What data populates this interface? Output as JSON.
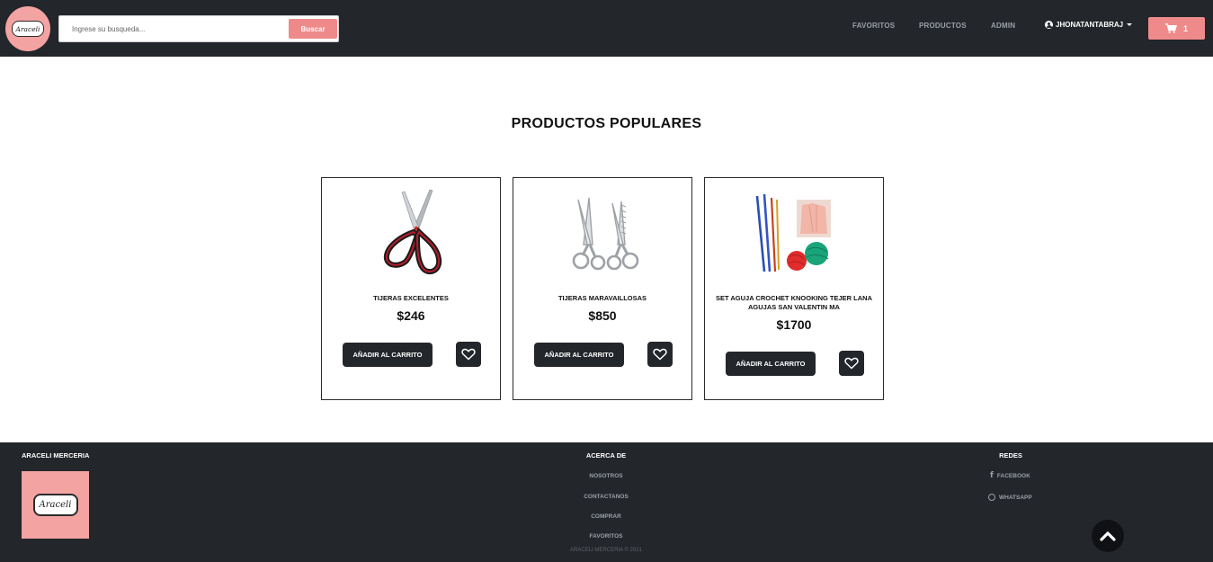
{
  "header": {
    "logo_text": "Araceli",
    "search": {
      "placeholder": "Ingrese su busqueda...",
      "value": "",
      "button_label": "Buscar"
    },
    "nav": [
      {
        "label": "FAVORITOS"
      },
      {
        "label": "PRODUCTOS"
      },
      {
        "label": "ADMIN"
      }
    ],
    "user": {
      "name": "JHONATANTABRAJ",
      "icon": "user-circle-icon"
    },
    "cart": {
      "count": "1",
      "icon": "shopping-cart-icon"
    }
  },
  "main": {
    "title": "PRODUCTOS POPULARES",
    "products": [
      {
        "name": "TIJERAS EXCELENTES",
        "price": "$246",
        "add_label": "AÑADIR AL CARRITO",
        "image_icon": "scissors-image"
      },
      {
        "name": "TIJERAS MARAVAILLOSAS",
        "price": "$850",
        "add_label": "AÑADIR AL CARRITO",
        "image_icon": "thinning-shears-image"
      },
      {
        "name": "SET AGUJA CROCHET KNOOKING TEJER LANA AGUJAS SAN VALENTIN MA",
        "price": "$1700",
        "add_label": "AÑADIR AL CARRITO",
        "image_icon": "crochet-set-image"
      }
    ]
  },
  "footer": {
    "brand": "ARACELI MERCERIA",
    "logo_text": "Araceli",
    "about": {
      "heading": "ACERCA DE",
      "links": [
        "NOSOTROS",
        "CONTACTANOS",
        "COMPRAR",
        "FAVORITOS"
      ]
    },
    "social": {
      "heading": "REDES",
      "links": [
        {
          "label": "FACEBOOK",
          "icon": "facebook-icon"
        },
        {
          "label": "WHATSAPP",
          "icon": "whatsapp-icon"
        }
      ]
    },
    "copyright": "ARACELI MERCERIA © 2021"
  },
  "colors": {
    "dark": "#23262b",
    "accent": "#ef8a8a",
    "logo_pink": "#f4a3a3"
  }
}
